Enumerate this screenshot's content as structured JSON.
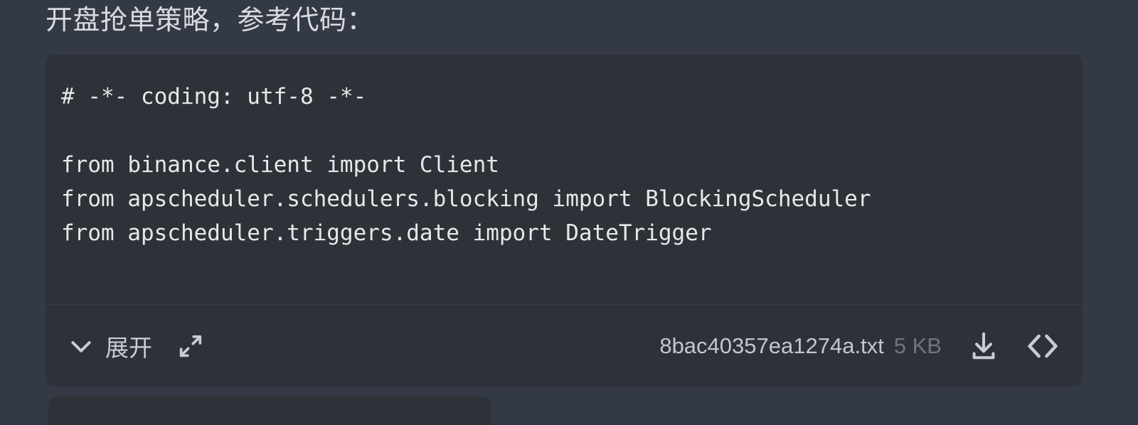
{
  "message": {
    "title": "开盘抢单策略，参考代码："
  },
  "code_block": {
    "language_hint": "python",
    "lines": [
      "# -*- coding: utf-8 -*-",
      "",
      "from binance.client import Client",
      "from apscheduler.schedulers.blocking import BlockingScheduler",
      "from apscheduler.triggers.date import DateTrigger"
    ],
    "footer": {
      "expand_label": "展开",
      "chevron_icon": "chevron-down-icon",
      "fullscreen_icon": "expand-diagonal-icon",
      "file_name": "8bac40357ea1274a.txt",
      "file_size": "5 KB",
      "download_icon": "download-icon",
      "code_view_icon": "code-brackets-icon"
    }
  },
  "colors": {
    "page_background": "#343a45",
    "card_background": "#2e3238",
    "title_text": "#d8dbe0",
    "code_text": "#e6e8ea",
    "file_name_text": "#c3c7cd",
    "file_size_text": "#70757d",
    "divider": "#3a3f47"
  }
}
